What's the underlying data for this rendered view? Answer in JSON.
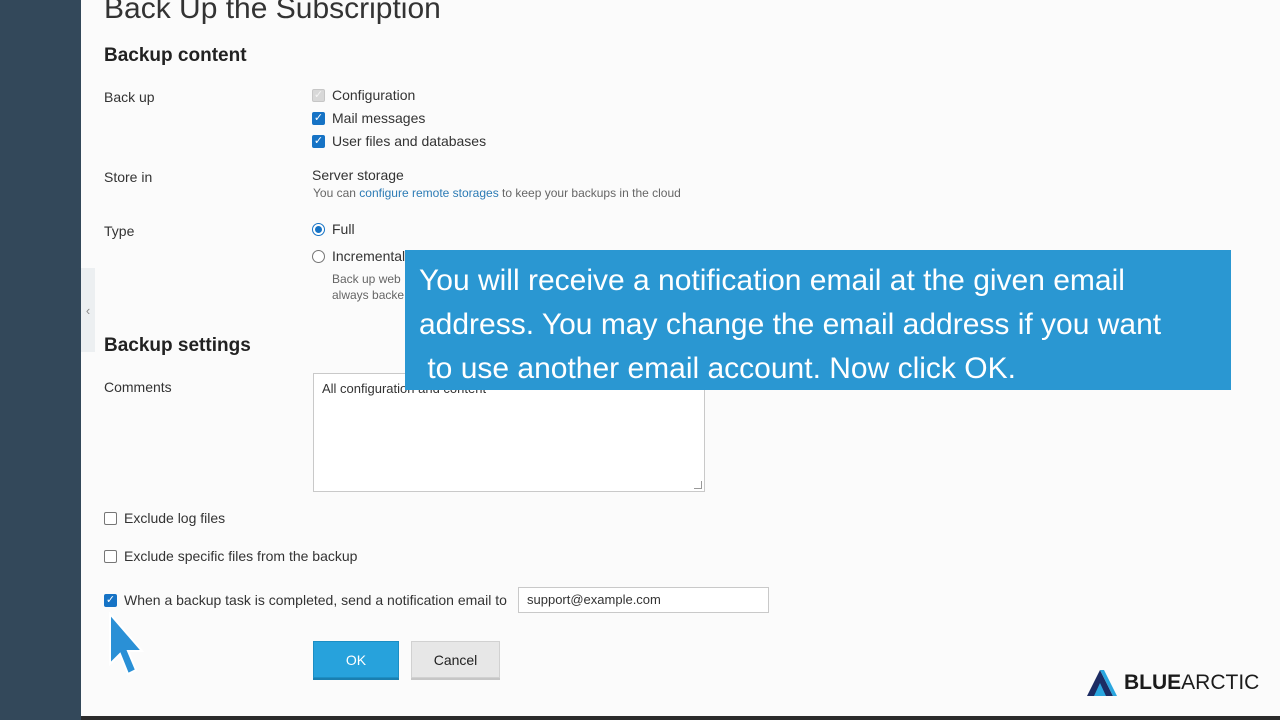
{
  "page": {
    "title": "Back Up the Subscription"
  },
  "backup_content": {
    "heading": "Backup content",
    "back_up": {
      "label": "Back up",
      "options": [
        {
          "label": "Configuration",
          "checked": true,
          "disabled": true
        },
        {
          "label": "Mail messages",
          "checked": true,
          "disabled": false
        },
        {
          "label": "User files and databases",
          "checked": true,
          "disabled": false
        }
      ]
    },
    "store_in": {
      "label": "Store in",
      "value": "Server storage",
      "hint_prefix": "You can",
      "hint_link": "configure remote storages",
      "hint_suffix": "to keep your backups in the cloud"
    },
    "type": {
      "label": "Type",
      "options": [
        {
          "label": "Full",
          "selected": true
        },
        {
          "label": "Incremental",
          "selected": false
        }
      ],
      "incremental_hint_line1": "Back up web",
      "incremental_hint_line2": "always backe"
    }
  },
  "backup_settings": {
    "heading": "Backup settings",
    "comments_label": "Comments",
    "comments_value": "All configuration and content",
    "exclude_log": {
      "label": "Exclude log files",
      "checked": false
    },
    "exclude_specific": {
      "label": "Exclude specific files from the backup",
      "checked": false
    },
    "notify": {
      "label": "When a backup task is completed, send a notification email to",
      "checked": true,
      "email": "support@example.com"
    }
  },
  "buttons": {
    "ok": "OK",
    "cancel": "Cancel"
  },
  "callout": {
    "line1": "You will receive a notification email at the given email",
    "line2": "address. You may change the email address if you want",
    "line3": " to use another email account. Now click OK."
  },
  "brand": {
    "bold": "BLUE",
    "regular": "ARCTIC"
  },
  "colors": {
    "accent": "#27a2dc",
    "callout_bg": "#2a97d2",
    "sidebar": "#33485a",
    "checkbox": "#1673c5"
  },
  "icons": {
    "collapse": "chevron-left-icon",
    "cursor": "mouse-pointer-icon",
    "logo": "bluearctic-logo-icon"
  }
}
